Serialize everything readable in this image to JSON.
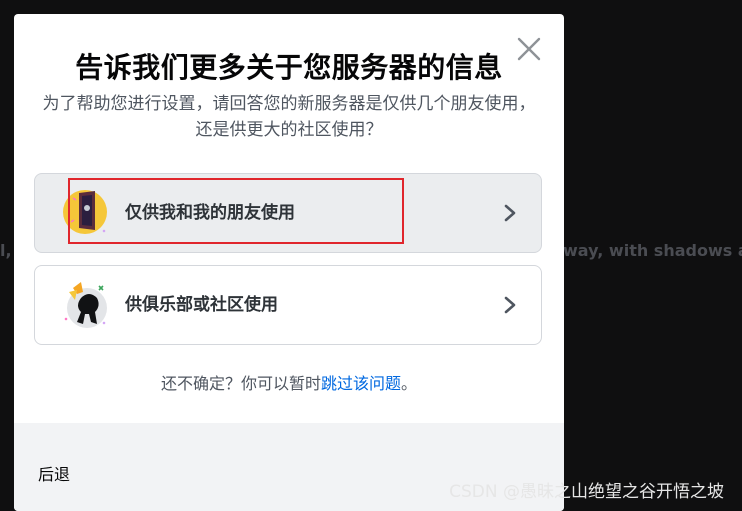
{
  "background": {
    "left_text": "l,",
    "right_text": "way, with shadows a"
  },
  "modal": {
    "title": "告诉我们更多关于您服务器的信息",
    "subtitle": "为了帮助您进行设置，请回答您的新服务器是仅供几个朋友使用，还是供更大的社区使用？",
    "options": [
      {
        "label": "仅供我和我的朋友使用",
        "icon": "door-character-icon",
        "state": "hover"
      },
      {
        "label": "供俱乐部或社区使用",
        "icon": "club-character-icon",
        "state": "default"
      }
    ],
    "helper_prefix": "还不确定？你可以暂时",
    "helper_link": "跳过该问题",
    "helper_suffix": "。",
    "back_label": "后退"
  },
  "watermark": "CSDN @愚昧之山绝望之谷开悟之坡",
  "colors": {
    "overlay": "#0f0f10",
    "link": "#0068e0",
    "hover_bg": "#ebedef",
    "highlight_box": "#e0262c",
    "footer_bg": "#f2f3f5"
  }
}
